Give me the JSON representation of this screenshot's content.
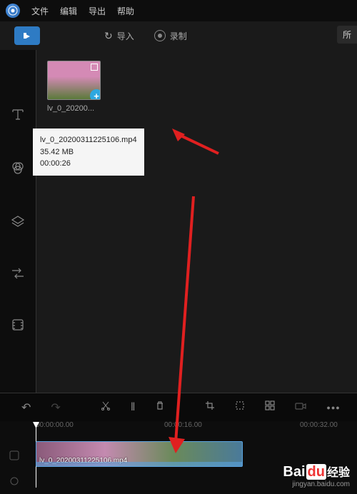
{
  "menu": {
    "items": [
      "文件",
      "编辑",
      "导出",
      "帮助"
    ]
  },
  "toolbar": {
    "import_label": "导入",
    "record_label": "录制",
    "filter_label": "所"
  },
  "media": {
    "item_label": "lv_0_20200...",
    "tooltip": {
      "filename": "lv_0_20200311225106.mp4",
      "filesize": "35.42 MB",
      "duration": "00:00:26"
    }
  },
  "timeline": {
    "marks": [
      "00:00:00.00",
      "00:00:16.00",
      "00:00:32.00"
    ],
    "clip_label": "lv_0_20200311225106.mp4"
  },
  "watermark": {
    "brand_prefix": "Bai",
    "brand_mid": "du",
    "brand_suffix": "经验",
    "url": "jingyan.baidu.com"
  }
}
